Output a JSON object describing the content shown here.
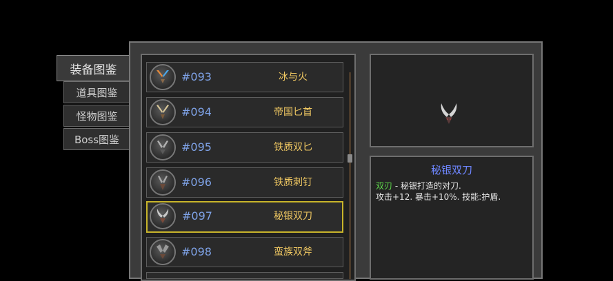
{
  "tabs": [
    {
      "label": "装备图鉴",
      "active": true
    },
    {
      "label": "道具图鉴",
      "active": false
    },
    {
      "label": "怪物图鉴",
      "active": false
    },
    {
      "label": "Boss图鉴",
      "active": false
    }
  ],
  "items": [
    {
      "num": "#093",
      "name": "冰与火",
      "icon": "fire-ice-blades-icon"
    },
    {
      "num": "#094",
      "name": "帝国匕首",
      "icon": "daggers-icon"
    },
    {
      "num": "#095",
      "name": "铁质双匕",
      "icon": "twin-daggers-icon"
    },
    {
      "num": "#096",
      "name": "铁质刺钉",
      "icon": "spike-icon"
    },
    {
      "num": "#097",
      "name": "秘银双刀",
      "icon": "twin-blades-icon",
      "selected": true
    },
    {
      "num": "#098",
      "name": "蛮族双斧",
      "icon": "twin-axes-icon"
    }
  ],
  "detail": {
    "title": "秘银双刀",
    "type_tag": "双刃",
    "desc_suffix": " - 秘银打造的对刀.",
    "stats": "攻击+12. 暴击+10%. 技能:护盾.",
    "preview_icon": "twin-blades-icon"
  },
  "colors": {
    "number": "#7fa3e8",
    "name": "#f0c862",
    "title": "#6e86ff",
    "tag": "#5ed84a",
    "selected_border": "#c9b52a"
  }
}
